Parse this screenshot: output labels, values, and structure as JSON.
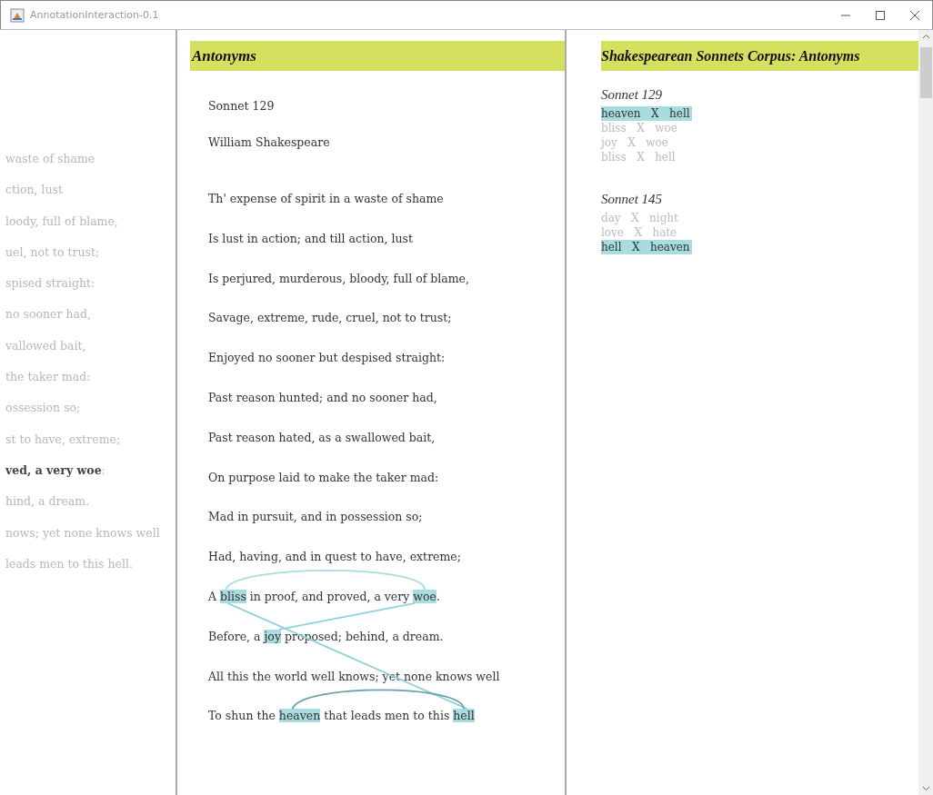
{
  "window": {
    "title": "AnnotationInteraction-0.1"
  },
  "left_pane": {
    "lines": [
      [
        {
          "text": "waste of shame",
          "emphasized": false
        }
      ],
      [
        {
          "text": "ction, lust",
          "emphasized": false
        }
      ],
      [
        {
          "text": "loody, full of blame,",
          "emphasized": false
        }
      ],
      [
        {
          "text": "uel, not to trust;",
          "emphasized": false
        }
      ],
      [
        {
          "text": "spised straight:",
          "emphasized": false
        }
      ],
      [
        {
          "text": "no sooner had,",
          "emphasized": false
        }
      ],
      [
        {
          "text": "vallowed bait,",
          "emphasized": false
        }
      ],
      [
        {
          "text": "the taker mad:",
          "emphasized": false
        }
      ],
      [
        {
          "text": "ossession so;",
          "emphasized": false
        }
      ],
      [
        {
          "text": "st to have, extreme;",
          "emphasized": false
        }
      ],
      [
        {
          "text": "ved, a very woe",
          "emphasized": true
        },
        {
          "text": ":",
          "emphasized": false
        }
      ],
      [
        {
          "text": "hind, a dream.",
          "emphasized": false
        }
      ],
      [
        {
          "text": "nows; yet none knows well",
          "emphasized": false
        }
      ],
      [
        {
          "text": "leads men to this hell.",
          "emphasized": false
        }
      ]
    ]
  },
  "poem": {
    "heading": "Antonyms",
    "title": "Sonnet 129",
    "author": "William Shakespeare",
    "lines": [
      [
        {
          "text": "Th' expense of spirit in a waste of shame",
          "highlighted": false
        }
      ],
      [
        {
          "text": "Is lust in action; and till action, lust",
          "highlighted": false
        }
      ],
      [
        {
          "text": "Is perjured, murderous, bloody, full of blame,",
          "highlighted": false
        }
      ],
      [
        {
          "text": "Savage, extreme, rude, cruel, not to trust;",
          "highlighted": false
        }
      ],
      [
        {
          "text": "Enjoyed no sooner but despised straight:",
          "highlighted": false
        }
      ],
      [
        {
          "text": "Past reason hunted; and no sooner had,",
          "highlighted": false
        }
      ],
      [
        {
          "text": "Past reason hated, as a swallowed bait,",
          "highlighted": false
        }
      ],
      [
        {
          "text": "On purpose laid to make the taker mad:",
          "highlighted": false
        }
      ],
      [
        {
          "text": "Mad in pursuit, and in possession so;",
          "highlighted": false
        }
      ],
      [
        {
          "text": "Had, having, and in quest to have, extreme;",
          "highlighted": false
        }
      ],
      [
        {
          "text": "A ",
          "highlighted": false
        },
        {
          "text": "bliss",
          "highlighted": true
        },
        {
          "text": " in proof, and proved, a very ",
          "highlighted": false
        },
        {
          "text": "woe",
          "highlighted": true
        },
        {
          "text": ".",
          "highlighted": false
        }
      ],
      [
        {
          "text": "Before, a ",
          "highlighted": false
        },
        {
          "text": "joy",
          "highlighted": true
        },
        {
          "text": " proposed; behind, a dream.",
          "highlighted": false
        }
      ],
      [
        {
          "text": "All this the world well knows; yet none knows well",
          "highlighted": false
        }
      ],
      [
        {
          "text": "To shun the ",
          "highlighted": false
        },
        {
          "text": "heaven",
          "highlighted": true
        },
        {
          "text": " that leads men to this ",
          "highlighted": false
        },
        {
          "text": "hell",
          "highlighted": true
        }
      ]
    ]
  },
  "corpus": {
    "heading": "Shakespearean Sonnets Corpus: Antonyms",
    "sonnets": [
      {
        "title": "Sonnet 129",
        "pairs": [
          {
            "first": "heaven",
            "separator": "X",
            "second": "hell",
            "highlighted": true
          },
          {
            "first": "bliss",
            "separator": "X",
            "second": "woe",
            "highlighted": false
          },
          {
            "first": "joy",
            "separator": "X",
            "second": "woe",
            "highlighted": false
          },
          {
            "first": "bliss",
            "separator": "X",
            "second": "hell",
            "highlighted": false
          }
        ]
      },
      {
        "title": "Sonnet 145",
        "pairs": [
          {
            "first": "day",
            "separator": "X",
            "second": "night",
            "highlighted": false
          },
          {
            "first": "love",
            "separator": "X",
            "second": "hate",
            "highlighted": false
          },
          {
            "first": "hell",
            "separator": "X",
            "second": "heaven",
            "highlighted": true
          }
        ]
      }
    ]
  }
}
